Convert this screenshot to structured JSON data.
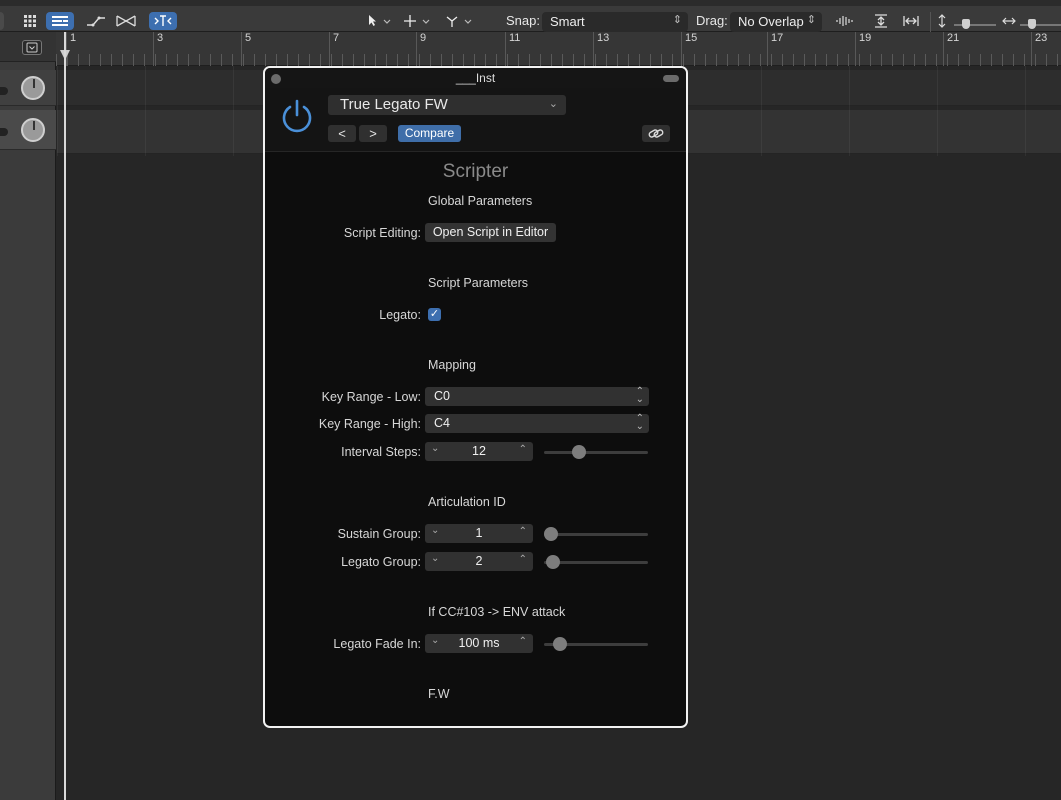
{
  "toolbar": {
    "snap_label": "Snap:",
    "snap_value": "Smart",
    "drag_label": "Drag:",
    "drag_value": "No Overlap"
  },
  "ruler": {
    "bars": [
      "1",
      "3",
      "5",
      "7",
      "9",
      "11",
      "13",
      "15",
      "17",
      "19",
      "21",
      "23"
    ]
  },
  "plugin": {
    "window_title": "___Inst",
    "preset_name": "True Legato FW",
    "prev_label": "<",
    "next_label": ">",
    "compare_label": "Compare",
    "plugin_name": "Scripter",
    "global_section": "Global Parameters",
    "script_editing_label": "Script Editing:",
    "open_editor_label": "Open Script in Editor",
    "script_section": "Script Parameters",
    "legato_label": "Legato:",
    "legato_checked": true,
    "mapping_section": "Mapping",
    "key_low_label": "Key Range - Low:",
    "key_low_value": "C0",
    "key_high_label": "Key Range - High:",
    "key_high_value": "C4",
    "interval_label": "Interval Steps:",
    "interval_value": "12",
    "articulation_section": "Articulation ID",
    "sustain_label": "Sustain Group:",
    "sustain_value": "1",
    "legato_group_label": "Legato Group:",
    "legato_group_value": "2",
    "cc_section": "If CC#103 -> ENV attack",
    "fade_label": "Legato Fade In:",
    "fade_value": "100 ms",
    "footer": "F.W"
  },
  "colors": {
    "accent": "#3d6fb0",
    "power": "#4a90d9"
  }
}
